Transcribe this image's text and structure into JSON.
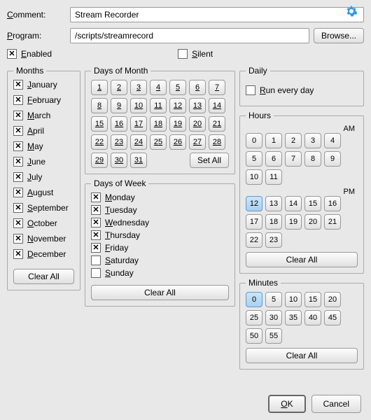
{
  "labels": {
    "comment": "Comment:",
    "program": "Program:",
    "browse": "Browse...",
    "enabled": "Enabled",
    "silent": "Silent",
    "ok": "OK",
    "cancel": "Cancel",
    "setAll": "Set All",
    "clearAll": "Clear All"
  },
  "fields": {
    "comment": "Stream Recorder",
    "program": "/scripts/streamrecord"
  },
  "checks": {
    "enabled": true,
    "silent": false
  },
  "groups": {
    "months": "Months",
    "dom": "Days of Month",
    "dow": "Days of Week",
    "daily": "Daily",
    "hours": "Hours",
    "minutes": "Minutes",
    "am": "AM",
    "pm": "PM",
    "runEveryDay": "Run every day"
  },
  "months": [
    {
      "label": "January",
      "checked": true
    },
    {
      "label": "February",
      "checked": true
    },
    {
      "label": "March",
      "checked": true
    },
    {
      "label": "April",
      "checked": true
    },
    {
      "label": "May",
      "checked": true
    },
    {
      "label": "June",
      "checked": true
    },
    {
      "label": "July",
      "checked": true
    },
    {
      "label": "August",
      "checked": true
    },
    {
      "label": "September",
      "checked": true
    },
    {
      "label": "October",
      "checked": true
    },
    {
      "label": "November",
      "checked": true
    },
    {
      "label": "December",
      "checked": true
    }
  ],
  "daysOfMonth": [
    1,
    2,
    3,
    4,
    5,
    6,
    7,
    8,
    9,
    10,
    11,
    12,
    13,
    14,
    15,
    16,
    17,
    18,
    19,
    20,
    21,
    22,
    23,
    24,
    25,
    26,
    27,
    28,
    29,
    30,
    31
  ],
  "daysOfWeek": [
    {
      "label": "Monday",
      "checked": true
    },
    {
      "label": "Tuesday",
      "checked": true
    },
    {
      "label": "Wednesday",
      "checked": true
    },
    {
      "label": "Thursday",
      "checked": true
    },
    {
      "label": "Friday",
      "checked": true
    },
    {
      "label": "Saturday",
      "checked": false
    },
    {
      "label": "Sunday",
      "checked": false
    }
  ],
  "daily": {
    "runEveryDay": false
  },
  "hours": {
    "am": [
      0,
      1,
      2,
      3,
      4,
      5,
      6,
      7,
      8,
      9,
      10,
      11
    ],
    "pm": [
      12,
      13,
      14,
      15,
      16,
      17,
      18,
      19,
      20,
      21,
      22,
      23
    ],
    "selected": [
      12
    ]
  },
  "minutes": {
    "values": [
      0,
      5,
      10,
      15,
      20,
      25,
      30,
      35,
      40,
      45,
      50,
      55
    ],
    "selected": [
      0
    ]
  }
}
